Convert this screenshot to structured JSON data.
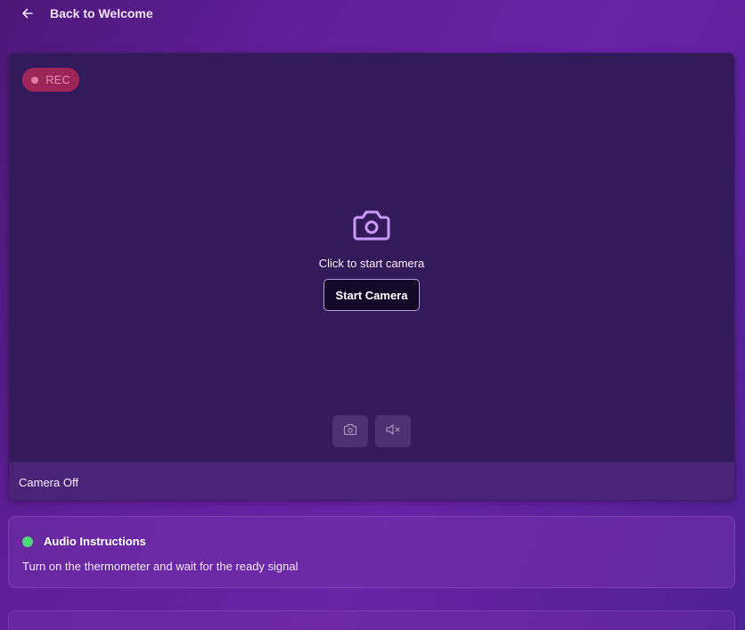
{
  "nav": {
    "back_label": "Back to Welcome",
    "back_icon": "arrow-left-icon"
  },
  "camera": {
    "rec_label": "REC",
    "prompt": "Click to start camera",
    "start_button": "Start Camera",
    "status": "Camera Off",
    "icons": {
      "center": "camera-icon",
      "snapshot": "camera-icon",
      "mute": "speaker-muted-icon"
    }
  },
  "audio_instructions": {
    "title": "Audio Instructions",
    "text": "Turn on the thermometer and wait for the ready signal",
    "indicator_color": "#52d67d"
  },
  "colors": {
    "rec_badge": "#9e2558",
    "accent": "#c99af7"
  }
}
